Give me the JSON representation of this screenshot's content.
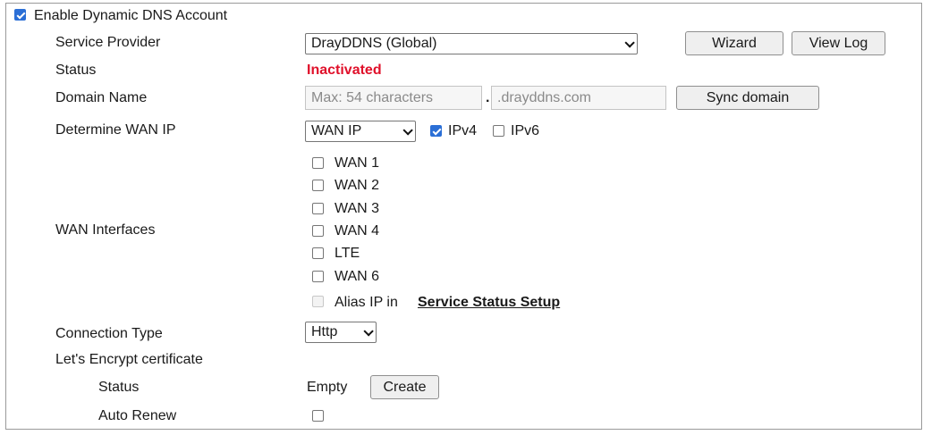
{
  "enable_account": {
    "label": "Enable Dynamic DNS Account",
    "checked": true
  },
  "service_provider": {
    "label": "Service Provider",
    "value": "DrayDDNS (Global)",
    "wizard": "Wizard",
    "view_log": "View Log"
  },
  "status": {
    "label": "Status",
    "value": "Inactivated",
    "color": "#e0102a"
  },
  "domain": {
    "label": "Domain Name",
    "placeholder": "Max: 54 characters",
    "suffix": ".drayddns.com",
    "sync": "Sync domain"
  },
  "wan_ip": {
    "label": "Determine WAN IP",
    "value": "WAN IP",
    "ipv4": "IPv4",
    "ipv4_checked": true,
    "ipv6": "IPv6",
    "ipv6_checked": false
  },
  "wan_interfaces": {
    "label": "WAN Interfaces",
    "items": [
      "WAN 1",
      "WAN 2",
      "WAN 3",
      "WAN 4",
      "LTE",
      "WAN 6"
    ],
    "alias_text": "Alias IP in",
    "alias_link": "Service Status Setup"
  },
  "connection_type": {
    "label": "Connection Type",
    "value": "Http"
  },
  "letsencrypt": {
    "label": "Let's Encrypt certificate",
    "status_label": "Status",
    "status_value": "Empty",
    "create": "Create",
    "auto_renew_label": "Auto Renew",
    "auto_renew_checked": false
  }
}
